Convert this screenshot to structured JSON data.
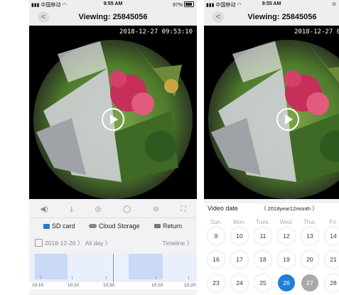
{
  "status": {
    "carrier": "中国移动",
    "time": "9:55 AM",
    "battery": "97%"
  },
  "nav": {
    "title": "Viewing: 25845056"
  },
  "video": {
    "timestamp": "2018-12-27 09:53:10"
  },
  "source_tabs": {
    "sd_card": "SD card",
    "cloud": "Cloud Storage",
    "return": "Return"
  },
  "date_row": {
    "date": "2018-12-26",
    "range": "All day",
    "view": "Timeline"
  },
  "timeline": {
    "labels": [
      "10:10",
      "10:20",
      "10:30",
      "10:10",
      "10:20"
    ]
  },
  "calendar": {
    "label": "Video date",
    "month": "2018year12month",
    "weekdays": [
      "Sun.",
      "Mon.",
      "Tues.",
      "Wed.",
      "Thur.",
      "Fri."
    ],
    "rows": [
      [
        "9",
        "10",
        "11",
        "12",
        "13",
        "14"
      ],
      [
        "16",
        "17",
        "18",
        "19",
        "20",
        "21"
      ],
      [
        "23",
        "24",
        "25",
        "26",
        "27",
        "28"
      ]
    ],
    "selected": "26",
    "today": "27",
    "accent": "#1f7ed8"
  },
  "icons": [
    "volume-icon",
    "download-icon",
    "camera-icon",
    "circle-view-icon",
    "cylinder-view-icon",
    "fullscreen-icon"
  ]
}
